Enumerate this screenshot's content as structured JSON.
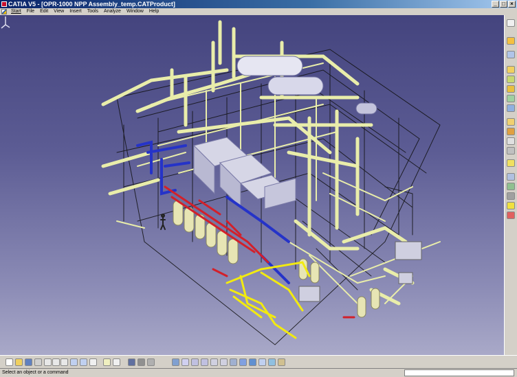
{
  "window": {
    "title": "CATIA V5 - [OPR-1000 NPP Assembly_temp.CATProduct]",
    "controls": [
      "_",
      "□",
      "×"
    ]
  },
  "menu": {
    "items": [
      "Start",
      "File",
      "Edit",
      "View",
      "Insert",
      "Tools",
      "Analyze",
      "Window",
      "Help"
    ]
  },
  "status": {
    "prompt": "Select an object or a command"
  },
  "colors": {
    "background_top": "#44447e",
    "background_bottom": "#a9a9c8",
    "pipe_yellow": "#e9edaa",
    "pipe_blue": "#2533c8",
    "pipe_red": "#d2202a",
    "bright_yellow": "#f2ea10"
  },
  "icons": {
    "right_toolbar": [
      "select-icon",
      "fly-icon",
      "product-icon",
      "component-icon",
      "part-icon",
      "existing-component-icon",
      "replace-icon",
      "graph-tree-icon",
      "generate-numbering-icon",
      "constraint-icon",
      "fix-icon",
      "snap-icon",
      "manipulate-icon",
      "explode-icon",
      "stop-manipulate-icon",
      "measure-icon",
      "scene-icon",
      "bill-of-material-icon"
    ],
    "bottom_toolbar": [
      "new-icon",
      "open-icon",
      "save-icon",
      "print-icon",
      "cut-icon",
      "copy-icon",
      "paste-icon",
      "undo-icon",
      "redo-icon",
      "whats-this-icon",
      "formula-icon",
      "comment-icon",
      "catalog-icon",
      "design-table-icon",
      "law-icon",
      "fly-mode-icon",
      "fit-all-icon",
      "pan-icon",
      "rotate-icon",
      "zoom-in-icon",
      "zoom-out-icon",
      "normal-view-icon",
      "views-icon",
      "render-style-icon",
      "hide-show-icon",
      "swap-visible-icon",
      "apply-material-icon"
    ]
  }
}
